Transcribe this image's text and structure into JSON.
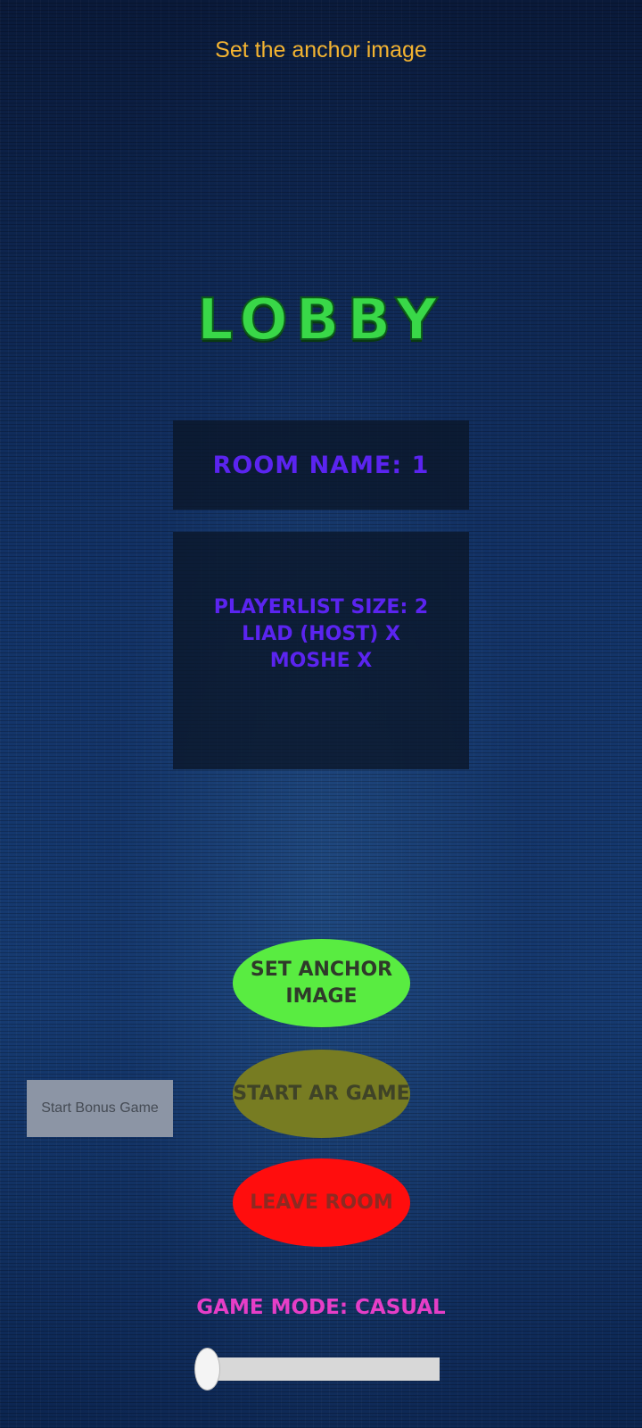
{
  "status_text": "Set the anchor image",
  "title": "LOBBY",
  "room": {
    "name_label": "ROOM NAME: 1"
  },
  "players": {
    "lines": [
      "PLAYERLIST SIZE: 2",
      "LIAD (HOST) X",
      "MOSHE X"
    ]
  },
  "buttons": {
    "set_anchor": "SET ANCHOR IMAGE",
    "start_ar": "START AR GAME",
    "leave_room": "LEAVE ROOM",
    "start_bonus": "Start Bonus Game"
  },
  "game_mode": {
    "label": "GAME MODE: CASUAL",
    "slider_value": 0
  },
  "colors": {
    "title": "#39d848",
    "panel_text": "#5b24f0",
    "status_text": "#f4b431",
    "game_mode_text": "#e63ec7",
    "set_anchor_button": "#59ec41",
    "start_ar_button": "#777c22",
    "leave_room_button": "#ff0d0d",
    "bonus_button": "#8c95a5"
  }
}
